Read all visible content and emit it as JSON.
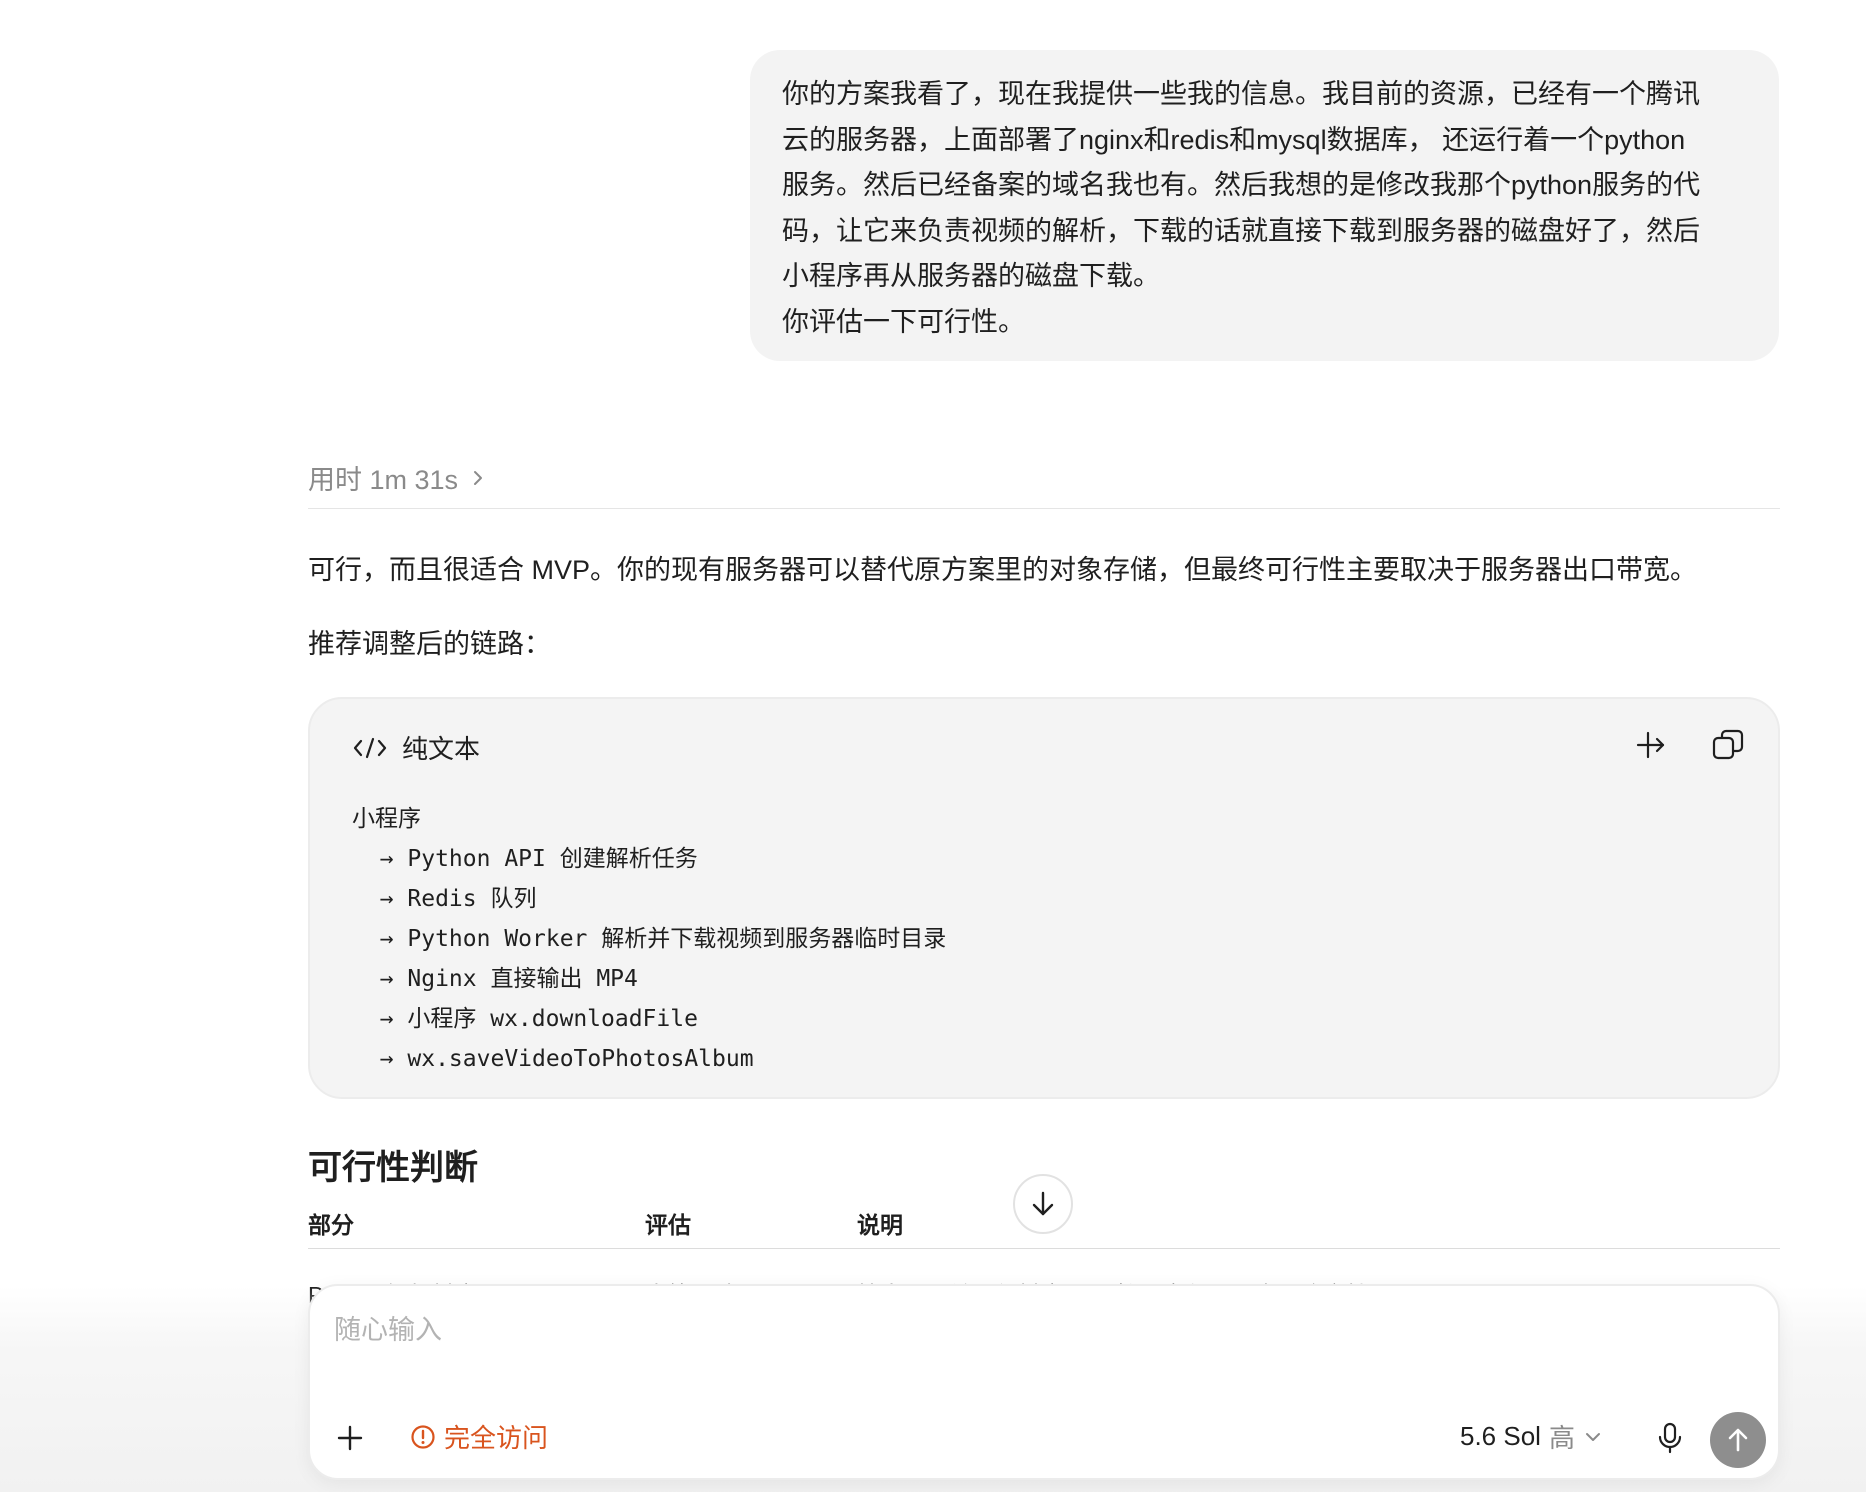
{
  "user_message": {
    "lines": [
      "你的方案我看了，现在我提供一些我的信息。我目前的资源，已经有一个腾讯",
      "云的服务器，上面部署了nginx和redis和mysql数据库， 还运行着一个python",
      "服务。然后已经备案的域名我也有。然后我想的是修改我那个python服务的代",
      "码，让它来负责视频的解析，下载的话就直接下载到服务器的磁盘好了，然后",
      "小程序再从服务器的磁盘下载。",
      "你评估一下可行性。"
    ]
  },
  "assistant": {
    "thinking_label": "用时 1m 31s",
    "intro": "可行，而且很适合 MVP。你的现有服务器可以替代原方案里的对象存储，但最终可行性主要取决于服务器出口带宽。",
    "chain_label": "推荐调整后的链路：",
    "code_block": {
      "language_label": "纯文本",
      "lines": [
        "小程序",
        "  → Python API 创建解析任务",
        "  → Redis 队列",
        "  → Python Worker 解析并下载视频到服务器临时目录",
        "  → Nginx 直接输出 MP4",
        "  → 小程序 wx.downloadFile",
        "  → wx.saveVideoToPhotosAlbum"
      ]
    },
    "section_title": "可行性判断",
    "table": {
      "headers": [
        "部分",
        "评估",
        "说明"
      ],
      "first_row_partial": [
        "Python 解析抖音",
        "中等风险",
        "技术上可做，但抖音页面/接口变化是最大不确定性"
      ]
    }
  },
  "composer": {
    "placeholder": "随心输入",
    "access_label": "完全访问",
    "model_label": "5.6 Sol",
    "effort_label": "高"
  },
  "colors": {
    "accent_warning": "#d9541e",
    "bubble_bg": "#f3f3f3",
    "send_button": "#8e8e8e"
  },
  "icons": {
    "thinking": "chevron-right-icon",
    "code": "code-icon",
    "wrap": "wrap-lines-icon",
    "copy": "copy-icon",
    "scroll": "arrow-down-icon",
    "plus": "plus-icon",
    "access": "warning-circle-icon",
    "model": "chevron-down-icon",
    "mic": "microphone-icon",
    "send": "arrow-up-icon"
  }
}
